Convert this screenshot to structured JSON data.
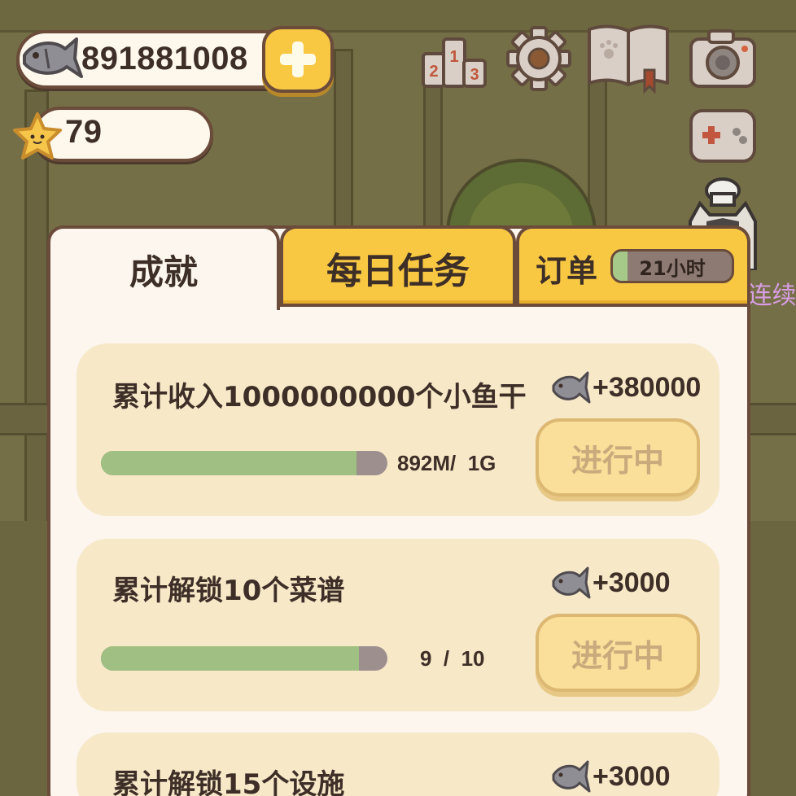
{
  "hud": {
    "fish_count": "891881008",
    "star_count": "79",
    "icons": [
      "fish-icon",
      "plus-icon",
      "star-icon",
      "ranking-icon",
      "gear-icon",
      "book-icon",
      "camera-icon",
      "gamepad-icon"
    ]
  },
  "side_text": "^o^连续",
  "tabs": {
    "achievement": "成就",
    "daily": "每日任务",
    "orders": "订单",
    "orders_timer": "21小时",
    "orders_timer_progress": 0.12,
    "active": "achievement"
  },
  "achievements": [
    {
      "title": "累计收入1000000000个小鱼干",
      "reward": "+380000",
      "progress_text": "892M/  1G",
      "progress": 0.892,
      "status": "进行中"
    },
    {
      "title": "累计解锁10个菜谱",
      "reward": "+3000",
      "progress_text": "9  /  10",
      "progress": 0.9,
      "status": "进行中"
    },
    {
      "title": "累计解锁15个设施",
      "reward": "+3000"
    }
  ],
  "colors": {
    "accent_yellow": "#f8c843",
    "outline_brown": "#6b4b3a",
    "card_bg": "#f7e8c8",
    "progress_green": "#a0bf82"
  }
}
